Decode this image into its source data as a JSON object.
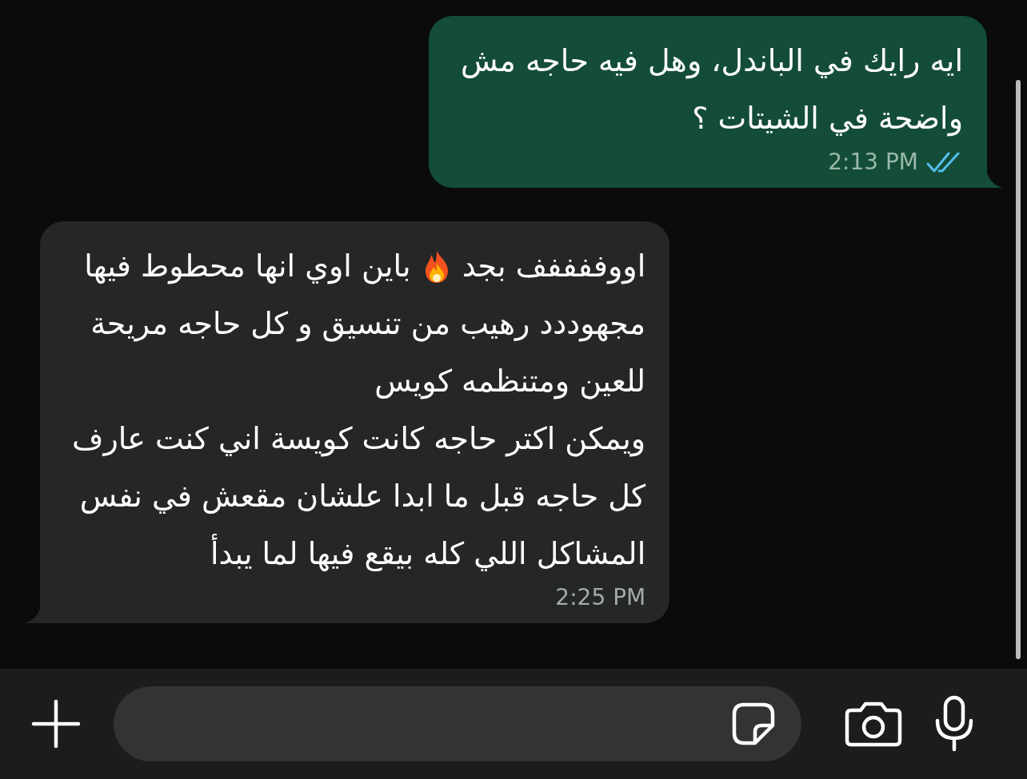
{
  "messages": [
    {
      "kind": "outgoing",
      "lines": [
        [
          {
            "kind": "text",
            "text": "ايه رايك في الباندل، وهل فيه حاجه مش"
          }
        ],
        [
          {
            "kind": "text",
            "text": "واضحة في الشيتات ؟"
          }
        ]
      ],
      "time": "2:13 PM",
      "read": true
    },
    {
      "kind": "incoming",
      "lines": [
        [
          {
            "kind": "text",
            "text": "اووففففف بجد"
          },
          {
            "kind": "emoji"
          },
          {
            "kind": "text",
            "text": "باين اوي انها محطوط فيها"
          }
        ],
        [
          {
            "kind": "text",
            "text": "مجهوددد رهيب من تنسيق و كل حاجه مريحة"
          }
        ],
        [
          {
            "kind": "text",
            "text": "للعين ومتنظمه كويس"
          }
        ],
        [
          {
            "kind": "text",
            "text": "ويمكن اكتر حاجه كانت كويسة اني كنت عارف"
          }
        ],
        [
          {
            "kind": "text",
            "text": "كل حاجه قبل ما ابدا علشان مقعش في نفس"
          }
        ],
        [
          {
            "kind": "text",
            "text": "المشاكل اللي كله بيقع فيها لما يبدأ"
          }
        ]
      ],
      "time": "2:25 PM"
    }
  ]
}
